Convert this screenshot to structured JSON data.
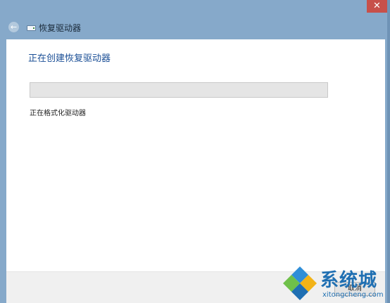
{
  "window": {
    "close_symbol": "✕",
    "title": "恢复驱动器",
    "back_symbol": "←"
  },
  "main": {
    "heading": "正在创建恢复驱动器",
    "status": "正在格式化驱动器",
    "progress_fraction": 0
  },
  "footer": {
    "cancel_label": "取消"
  },
  "watermark": {
    "brand": "系统城",
    "url": "xitongcheng.com"
  },
  "colors": {
    "frame": "#86a9ca",
    "heading": "#1b4f96",
    "close_button": "#c7504a",
    "progress_track": "#e5e5e5",
    "logo": "#1f6fb2"
  }
}
